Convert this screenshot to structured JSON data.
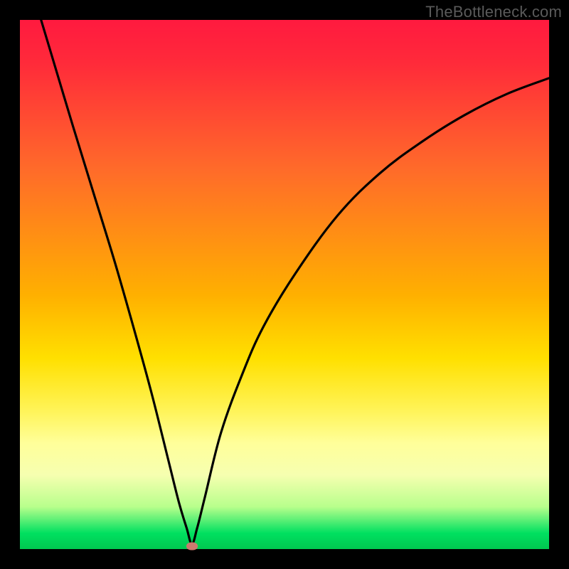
{
  "watermark": "TheBottleneck.com",
  "chart_data": {
    "type": "line",
    "title": "",
    "xlabel": "",
    "ylabel": "",
    "xlim": [
      0,
      100
    ],
    "ylim": [
      0,
      100
    ],
    "grid": false,
    "series": [
      {
        "name": "bottleneck-curve",
        "x": [
          4,
          7,
          10,
          14,
          18,
          22,
          25,
          28,
          30,
          31.5,
          32.5,
          33.5,
          35,
          38,
          42,
          46,
          52,
          60,
          68,
          76,
          84,
          92,
          100
        ],
        "y": [
          100,
          90,
          80,
          67,
          54,
          40,
          29,
          17,
          9,
          4,
          1,
          4,
          10,
          22,
          33,
          42,
          52,
          63,
          71,
          77,
          82,
          86,
          89
        ]
      }
    ],
    "marker": {
      "x": 32.5,
      "y": 0.6
    },
    "background_gradient": {
      "top": "#ff1a3f",
      "mid": "#ffe000",
      "bottom": "#00c850"
    }
  }
}
